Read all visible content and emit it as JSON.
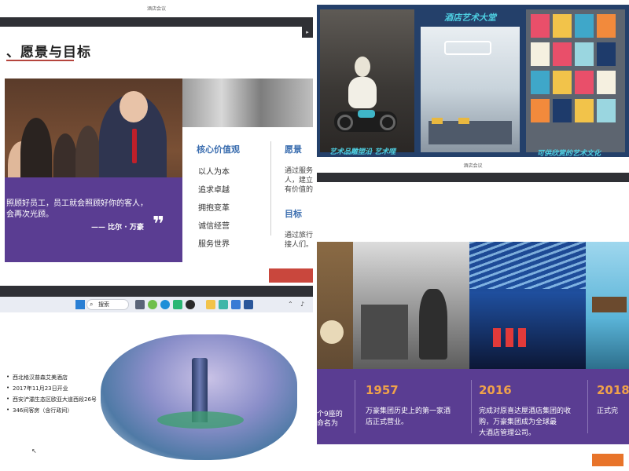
{
  "panel_a": {
    "window_title": "酒店会议",
    "heading": "、愿景与目标",
    "quote_line1": "照顾好员工，员工就会照顾好你的客人，",
    "quote_line2": "会再次光顾。",
    "quote_author": "—— 比尔 · 万豪",
    "quote_mark": "❞",
    "values_title": "核心价值观",
    "values": [
      "以人为本",
      "追求卓越",
      "拥抱变革",
      "诚信经营",
      "服务世界"
    ],
    "vision_title": "愿景",
    "vision_text": [
      "通过服务",
      "人，建立",
      "有价值的"
    ],
    "goal_title": "目标",
    "goal_text": [
      "通过旅行",
      "接人们。"
    ]
  },
  "panel_b": {
    "title": "酒店艺术大堂",
    "caption_left": "艺术品雕塑沿 艺术哩",
    "caption_right": "可供欣赏的艺术文化"
  },
  "panel_c": {
    "search_label": "搜索",
    "bullets": [
      "西北格汉普森艾美酒店",
      "2017年11月23日开业",
      "西安浐灞生态区欧亚大道西段26号",
      "346间客房（含行政间）"
    ],
    "taskbar_icons": [
      "files-icon",
      "browser-icon",
      "edge-icon",
      "chat-icon",
      "qq-icon",
      "folder-icon",
      "app-icon",
      "store-icon",
      "word-icon"
    ]
  },
  "panel_d": {
    "window_title": "酒店会议",
    "left_caption": [
      "个9座的",
      "命名为"
    ],
    "milestones": [
      {
        "year": "1957",
        "desc": [
          "万豪集团历史上的第一家酒",
          "店正式营业。"
        ]
      },
      {
        "year": "2016",
        "desc": [
          "完成对原喜达屋酒店集团的收",
          "购，万豪集团成为全球最",
          "大酒店管理公司。"
        ]
      },
      {
        "year": "2018",
        "desc": [
          "正式完"
        ]
      }
    ]
  },
  "colors": {
    "purple_band": "#5a3d92",
    "accent_blue": "#3d6fb0",
    "year_orange": "#f0a24a",
    "heading_red": "#b5453d",
    "dark_bar": "#2f3035"
  }
}
